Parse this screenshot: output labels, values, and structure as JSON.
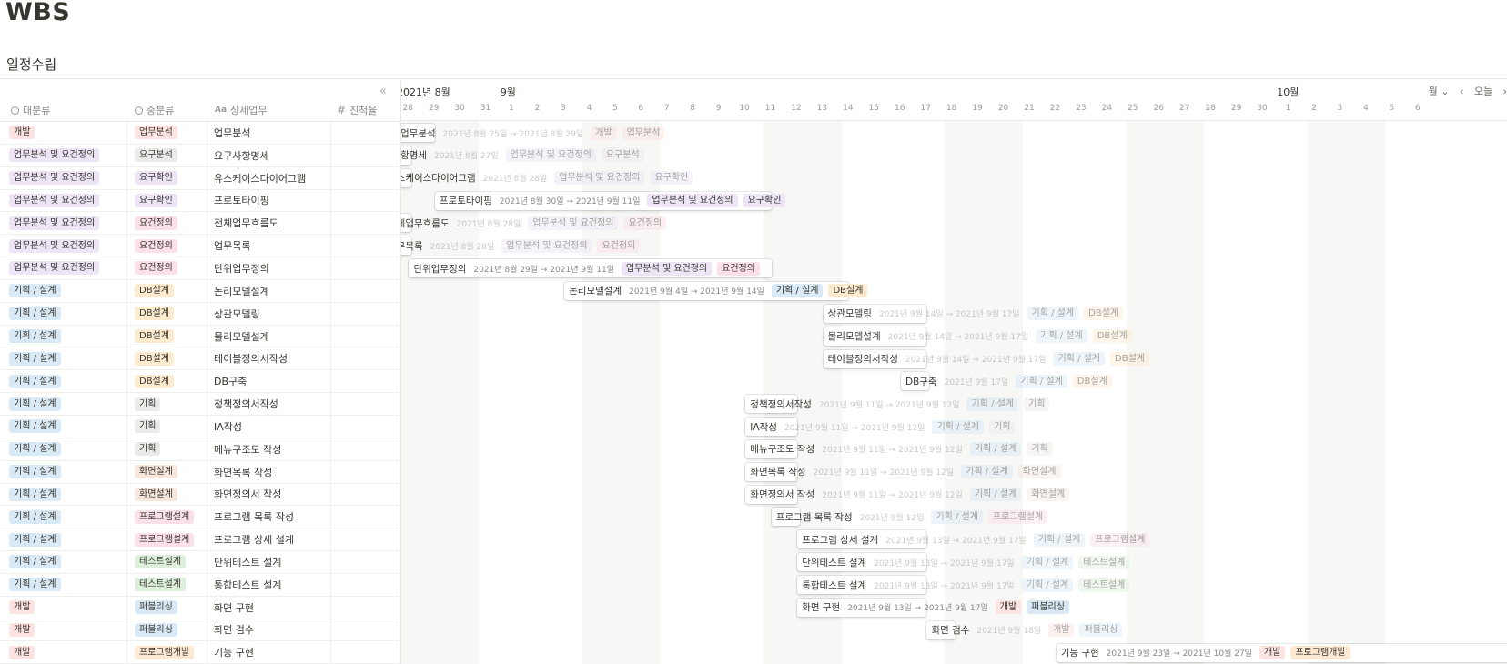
{
  "page": {
    "title": "WBS",
    "view_title": "일정수립"
  },
  "colors": {
    "개발": "#fde3e2",
    "업무분석 및 요건정의": "#ede4f6",
    "기획 / 설계": "#d9e9f5",
    "업무분석": "#fde3e2",
    "요구분석": "#eceae8",
    "요구확인": "#ede4f6",
    "요건정의": "#fbe0e9",
    "DB설계": "#fcebcf",
    "기획": "#eceae8",
    "화면설계": "#f6e6dc",
    "프로그램설계": "#fbe0e9",
    "테스트설계": "#ddeedd",
    "퍼블리싱": "#d9e9f5",
    "프로그램개발": "#fde8d2"
  },
  "table": {
    "collapse_icon": "«",
    "headers": [
      {
        "label": "대분류",
        "icon": "select-icon"
      },
      {
        "label": "중분류",
        "icon": "select-icon"
      },
      {
        "label": "상세업무",
        "icon": "text-icon",
        "icon_text": "Aa"
      },
      {
        "label": "진척율",
        "icon": "number-icon",
        "icon_text": "#"
      }
    ],
    "rows": [
      {
        "cat": "개발",
        "sub": "업무분석",
        "task": "업무분석"
      },
      {
        "cat": "업무분석 및 요건정의",
        "sub": "요구분석",
        "task": "요구사항명세"
      },
      {
        "cat": "업무분석 및 요건정의",
        "sub": "요구확인",
        "task": "유스케이스다이어그램"
      },
      {
        "cat": "업무분석 및 요건정의",
        "sub": "요구확인",
        "task": "프로토타이핑"
      },
      {
        "cat": "업무분석 및 요건정의",
        "sub": "요건정의",
        "task": "전체업무흐름도"
      },
      {
        "cat": "업무분석 및 요건정의",
        "sub": "요건정의",
        "task": "업무목록"
      },
      {
        "cat": "업무분석 및 요건정의",
        "sub": "요건정의",
        "task": "단위업무정의"
      },
      {
        "cat": "기획 / 설계",
        "sub": "DB설계",
        "task": "논리모델설계"
      },
      {
        "cat": "기획 / 설계",
        "sub": "DB설계",
        "task": "상관모델링"
      },
      {
        "cat": "기획 / 설계",
        "sub": "DB설계",
        "task": "물리모델설계"
      },
      {
        "cat": "기획 / 설계",
        "sub": "DB설계",
        "task": "테이블정의서작성"
      },
      {
        "cat": "기획 / 설계",
        "sub": "DB설계",
        "task": "DB구축"
      },
      {
        "cat": "기획 / 설계",
        "sub": "기획",
        "task": "정책정의서작성"
      },
      {
        "cat": "기획 / 설계",
        "sub": "기획",
        "task": "IA작성"
      },
      {
        "cat": "기획 / 설계",
        "sub": "기획",
        "task": "메뉴구조도 작성"
      },
      {
        "cat": "기획 / 설계",
        "sub": "화면설계",
        "task": "화면목록 작성"
      },
      {
        "cat": "기획 / 설계",
        "sub": "화면설계",
        "task": "화면정의서 작성"
      },
      {
        "cat": "기획 / 설계",
        "sub": "프로그램설계",
        "task": "프로그램 목록 작성"
      },
      {
        "cat": "기획 / 설계",
        "sub": "프로그램설계",
        "task": "프로그램 상세 설계"
      },
      {
        "cat": "기획 / 설계",
        "sub": "테스트설계",
        "task": "단위테스트 설계"
      },
      {
        "cat": "기획 / 설계",
        "sub": "테스트설계",
        "task": "통합테스트 설계"
      },
      {
        "cat": "개발",
        "sub": "퍼블리싱",
        "task": "화면 구현"
      },
      {
        "cat": "개발",
        "sub": "퍼블리싱",
        "task": "화면 검수"
      },
      {
        "cat": "개발",
        "sub": "프로그램개발",
        "task": "기능 구현"
      }
    ]
  },
  "timeline": {
    "months": [
      {
        "label": "2021년 8월",
        "index": 0
      },
      {
        "label": "9월",
        "index": 4
      },
      {
        "label": "10월",
        "index": 34
      }
    ],
    "days": [
      "28",
      "29",
      "30",
      "31",
      "1",
      "2",
      "3",
      "4",
      "5",
      "6",
      "7",
      "8",
      "9",
      "10",
      "11",
      "12",
      "13",
      "14",
      "15",
      "16",
      "17",
      "18",
      "19",
      "20",
      "21",
      "22",
      "23",
      "24",
      "25",
      "26",
      "27",
      "28",
      "29",
      "30",
      "1",
      "2",
      "3",
      "4",
      "5",
      "6"
    ],
    "weekend_days": [
      0,
      1,
      7,
      8,
      14,
      15,
      21,
      22,
      28,
      29,
      35,
      36
    ],
    "controls": {
      "view_label": "월",
      "prev": "‹",
      "today": "오늘",
      "next": "›"
    },
    "bars": [
      {
        "name": "업무분석",
        "dates": "2021년 8월 25일 → 2021년 8월 29일",
        "tags": [
          "개발",
          "업무분석"
        ],
        "start": 0,
        "end": 2,
        "faded": true,
        "icon": true
      },
      {
        "name": "요구사항명세",
        "display": "항명세",
        "dates": "2021년 8월 27일",
        "tags": [
          "업무분석 및 요건정의",
          "요구분석"
        ],
        "start": 0,
        "end": 1,
        "faded": true,
        "icon": true
      },
      {
        "name": "유스케이스다이어그램",
        "display": "유스케이스다이어그램",
        "dates": "2021년 8월 28일",
        "tags": [
          "업무분석 및 요건정의",
          "요구확인"
        ],
        "start": 0,
        "end": 1,
        "faded": true
      },
      {
        "name": "프로토타이핑",
        "dates": "2021년 8월 30일 → 2021년 9월 11일",
        "tags": [
          "업무분석 및 요건정의",
          "요구확인"
        ],
        "start": 2,
        "end": 15,
        "faded": false
      },
      {
        "name": "전체업무흐름도",
        "dates": "2021년 8월 28일",
        "tags": [
          "업무분석 및 요건정의",
          "요건정의"
        ],
        "start": 0,
        "end": 1,
        "faded": true
      },
      {
        "name": "업무목록",
        "dates": "2021년 8월 28일",
        "tags": [
          "업무분석 및 요건정의",
          "요건정의"
        ],
        "start": 0,
        "end": 1,
        "faded": true
      },
      {
        "name": "단위업무정의",
        "dates": "2021년 8월 29일 → 2021년 9월 11일",
        "tags": [
          "업무분석 및 요건정의",
          "요건정의"
        ],
        "start": 1,
        "end": 15,
        "faded": false
      },
      {
        "name": "논리모델설계",
        "dates": "2021년 9월 4일 → 2021년 9월 14일",
        "tags": [
          "기획 / 설계",
          "DB설계"
        ],
        "start": 7,
        "end": 18,
        "faded": false
      },
      {
        "name": "상관모델링",
        "dates": "2021년 9월 14일 → 2021년 9월 17일",
        "tags": [
          "기획 / 설계",
          "DB설계"
        ],
        "start": 17,
        "end": 21,
        "faded": true
      },
      {
        "name": "물리모델설계",
        "dates": "2021년 9월 14일 → 2021년 9월 17일",
        "tags": [
          "기획 / 설계",
          "DB설계"
        ],
        "start": 17,
        "end": 21,
        "faded": true
      },
      {
        "name": "테이블정의서작성",
        "dates": "2021년 9월 14일 → 2021년 9월 17일",
        "tags": [
          "기획 / 설계",
          "DB설계"
        ],
        "start": 17,
        "end": 21,
        "faded": true
      },
      {
        "name": "DB구축",
        "dates": "2021년 9월 17일",
        "tags": [
          "기획 / 설계",
          "DB설계"
        ],
        "start": 20,
        "end": 21,
        "faded": true
      },
      {
        "name": "정책정의서작성",
        "dates": "2021년 9월 11일 → 2021년 9월 12일",
        "tags": [
          "기획 / 설계",
          "기획"
        ],
        "start": 14,
        "end": 16,
        "faded": true
      },
      {
        "name": "IA작성",
        "dates": "2021년 9월 11일 → 2021년 9월 12일",
        "tags": [
          "기획 / 설계",
          "기획"
        ],
        "start": 14,
        "end": 16,
        "faded": true
      },
      {
        "name": "메뉴구조도 작성",
        "dates": "2021년 9월 11일 → 2021년 9월 12일",
        "tags": [
          "기획 / 설계",
          "기획"
        ],
        "start": 14,
        "end": 16,
        "faded": true
      },
      {
        "name": "화면목록 작성",
        "dates": "2021년 9월 11일 → 2021년 9월 12일",
        "tags": [
          "기획 / 설계",
          "화면설계"
        ],
        "start": 14,
        "end": 16,
        "faded": true
      },
      {
        "name": "화면정의서 작성",
        "dates": "2021년 9월 11일 → 2021년 9월 12일",
        "tags": [
          "기획 / 설계",
          "화면설계"
        ],
        "start": 14,
        "end": 16,
        "faded": true
      },
      {
        "name": "프로그램 목록 작성",
        "dates": "2021년 9월 12일",
        "tags": [
          "기획 / 설계",
          "프로그램설계"
        ],
        "start": 15,
        "end": 16,
        "faded": true
      },
      {
        "name": "프로그램 상세 설계",
        "dates": "2021년 9월 13일 → 2021년 9월 17일",
        "tags": [
          "기획 / 설계",
          "프로그램설계"
        ],
        "start": 16,
        "end": 21,
        "faded": true
      },
      {
        "name": "단위테스트 설계",
        "dates": "2021년 9월 13일 → 2021년 9월 17일",
        "tags": [
          "기획 / 설계",
          "테스트설계"
        ],
        "start": 16,
        "end": 21,
        "faded": true
      },
      {
        "name": "통합테스트 설계",
        "dates": "2021년 9월 13일 → 2021년 9월 17일",
        "tags": [
          "기획 / 설계",
          "테스트설계"
        ],
        "start": 16,
        "end": 21,
        "faded": true
      },
      {
        "name": "화면 구현",
        "dates": "2021년 9월 13일 → 2021년 9월 17일",
        "tags": [
          "개발",
          "퍼블리싱"
        ],
        "start": 16,
        "end": 21,
        "faded": false
      },
      {
        "name": "화면 검수",
        "dates": "2021년 9월 18일",
        "tags": [
          "개발",
          "퍼블리싱"
        ],
        "start": 21,
        "end": 22,
        "faded": true
      },
      {
        "name": "기능 구현",
        "dates": "2021년 9월 23일 → 2021년 10월 27일",
        "tags": [
          "개발",
          "프로그램개발"
        ],
        "start": 26,
        "end": 60,
        "faded": false
      }
    ]
  }
}
